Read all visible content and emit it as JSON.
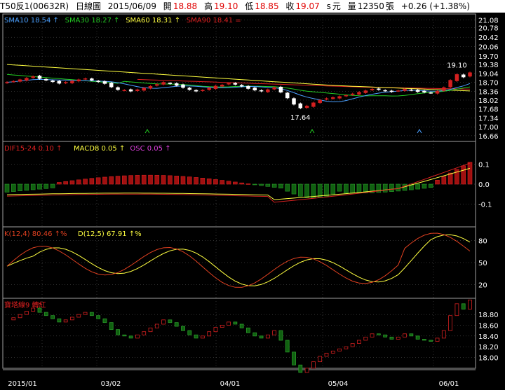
{
  "header": {
    "symbol": "T50反1(00632R)",
    "period": "日線圖",
    "date": "2015/06/09",
    "open_label": "開",
    "open": "18.88",
    "high_label": "高",
    "high": "19.10",
    "low_label": "低",
    "low": "18.85",
    "close_label": "收",
    "close": "19.07",
    "unit_s": "s",
    "unit_yuan": "元",
    "vol_label": "量",
    "volume": "12350",
    "vol_unit": "張",
    "change": "+0.26 (+1.38%)"
  },
  "colors": {
    "up": "#d42020",
    "down": "#2a9a2a",
    "sma10": "#4aa0ff",
    "sma30": "#22cc22",
    "sma60": "#ffff40",
    "sma90": "#e02020",
    "k": "#e04020",
    "d": "#ffff40",
    "grid": "#606060",
    "panel_border": "#a0a0a0"
  },
  "chart_data": [
    {
      "type": "candlestick",
      "panel": "price",
      "legend": [
        {
          "text": "SMA10 18.54",
          "arrow": "↑",
          "color": "#4aa0ff"
        },
        {
          "text": "SMA30 18.27",
          "arrow": "↑",
          "color": "#22cc22"
        },
        {
          "text": "SMA60 18.31",
          "arrow": "↑",
          "color": "#ffff40"
        },
        {
          "text": "SMA90 18.41",
          "arrow": "=",
          "color": "#e02020"
        }
      ],
      "ylim": [
        16.55,
        21.2
      ],
      "yticks": [
        "21.08",
        "20.78",
        "20.42",
        "20.06",
        "19.70",
        "19.38",
        "19.04",
        "18.70",
        "18.36",
        "18.02",
        "17.68",
        "17.34",
        "17.00",
        "16.66"
      ],
      "annotations": [
        {
          "text": "19.10",
          "index": 69,
          "value": 19.1
        },
        {
          "text": "17.64",
          "index": 45,
          "value": 17.64
        }
      ],
      "closes": [
        18.7,
        18.74,
        18.8,
        18.86,
        18.92,
        18.84,
        18.78,
        18.72,
        18.66,
        18.7,
        18.75,
        18.8,
        18.84,
        18.78,
        18.72,
        18.65,
        18.52,
        18.42,
        18.4,
        18.36,
        18.42,
        18.48,
        18.55,
        18.62,
        18.7,
        18.65,
        18.58,
        18.5,
        18.42,
        18.36,
        18.4,
        18.48,
        18.56,
        18.6,
        18.66,
        18.62,
        18.55,
        18.46,
        18.4,
        18.36,
        18.42,
        18.5,
        18.32,
        18.1,
        17.86,
        17.72,
        17.8,
        17.92,
        18.02,
        18.08,
        18.12,
        18.16,
        18.2,
        18.26,
        18.32,
        18.38,
        18.44,
        18.42,
        18.38,
        18.34,
        18.38,
        18.44,
        18.4,
        18.34,
        18.32,
        18.3,
        18.36,
        18.5,
        18.78,
        19.0,
        18.9,
        19.07
      ]
    },
    {
      "type": "bar+line",
      "panel": "macd",
      "legend": [
        {
          "text": "DIF15-24 0.10",
          "arrow": "↑",
          "color": "#e02020"
        },
        {
          "text": "MACD8 0.05",
          "arrow": "↑",
          "color": "#ffff40"
        },
        {
          "text": "OSC 0.05",
          "arrow": "↑",
          "color": "#e040e0"
        }
      ],
      "ylim": [
        -0.2,
        0.2
      ],
      "yticks": [
        "0.1",
        "0.0",
        "-0.1"
      ]
    },
    {
      "type": "line",
      "panel": "kd",
      "legend": [
        {
          "text": "K(12,4) 80.46",
          "arrow": "↑%",
          "color": "#e04020"
        },
        {
          "text": "D(12,5) 67.91",
          "arrow": "↑%",
          "color": "#ffff40"
        }
      ],
      "ylim": [
        5,
        95
      ],
      "yticks": [
        "80",
        "50",
        "20"
      ]
    },
    {
      "type": "step",
      "panel": "breakout",
      "legend": [
        {
          "text": "寶塔線9 轉紅",
          "arrow": "",
          "color": "#e02020"
        }
      ],
      "ylim": [
        17.85,
        19.05
      ],
      "yticks": [
        "18.80",
        "18.60",
        "18.40",
        "18.20",
        "18.00"
      ]
    }
  ],
  "xaxis": {
    "labels": [
      "2015/01",
      "03/02",
      "04/01",
      "05/04",
      "06/01"
    ]
  }
}
